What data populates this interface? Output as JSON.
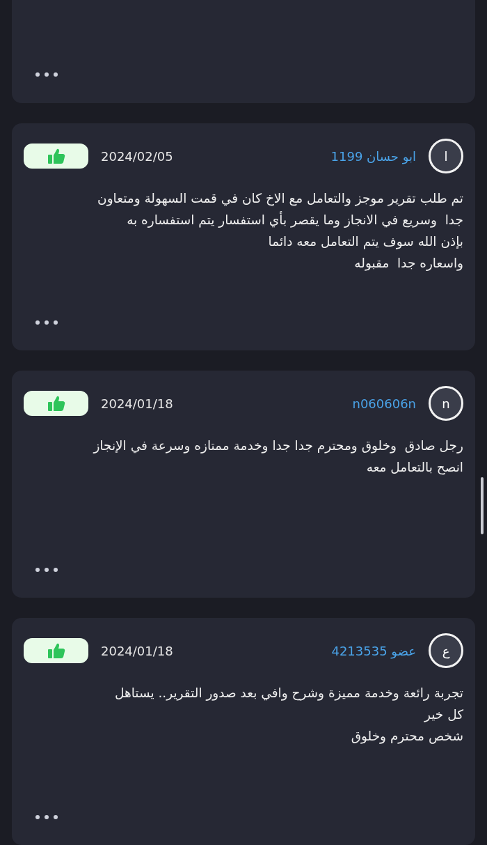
{
  "reviews": [
    {
      "kind": "truncated"
    },
    {
      "kind": "full",
      "avatar_letter": "ا",
      "author": "ابو حسان 1199",
      "date": "2024/02/05",
      "lines": [
        "تم طلب تقرير موجز والتعامل مع الاخ كان في قمت السهولة ومتعاون",
        "جدا  وسريع في الانجاز وما يقصر بأي استفسار يتم استفساره به",
        "بإذن الله سوف يتم التعامل معه دائما",
        "واسعاره جدا  مقبوله"
      ]
    },
    {
      "kind": "full",
      "avatar_letter": "n",
      "author": "n060606n",
      "date": "2024/01/18",
      "lines": [
        "رجل صادق  وخلوق ومحترم جدا جدا وخدمة ممتازه وسرعة في الإنجاز",
        "انصح بالتعامل معه"
      ]
    },
    {
      "kind": "full",
      "avatar_letter": "ع",
      "author": "عضو 4213535",
      "date": "2024/01/18",
      "lines": [
        "تجربة رائعة وخدمة مميزة وشرح وافي بعد صدور التقرير.. يستاهل",
        "كل خير",
        "شخص محترم وخلوق"
      ]
    }
  ]
}
